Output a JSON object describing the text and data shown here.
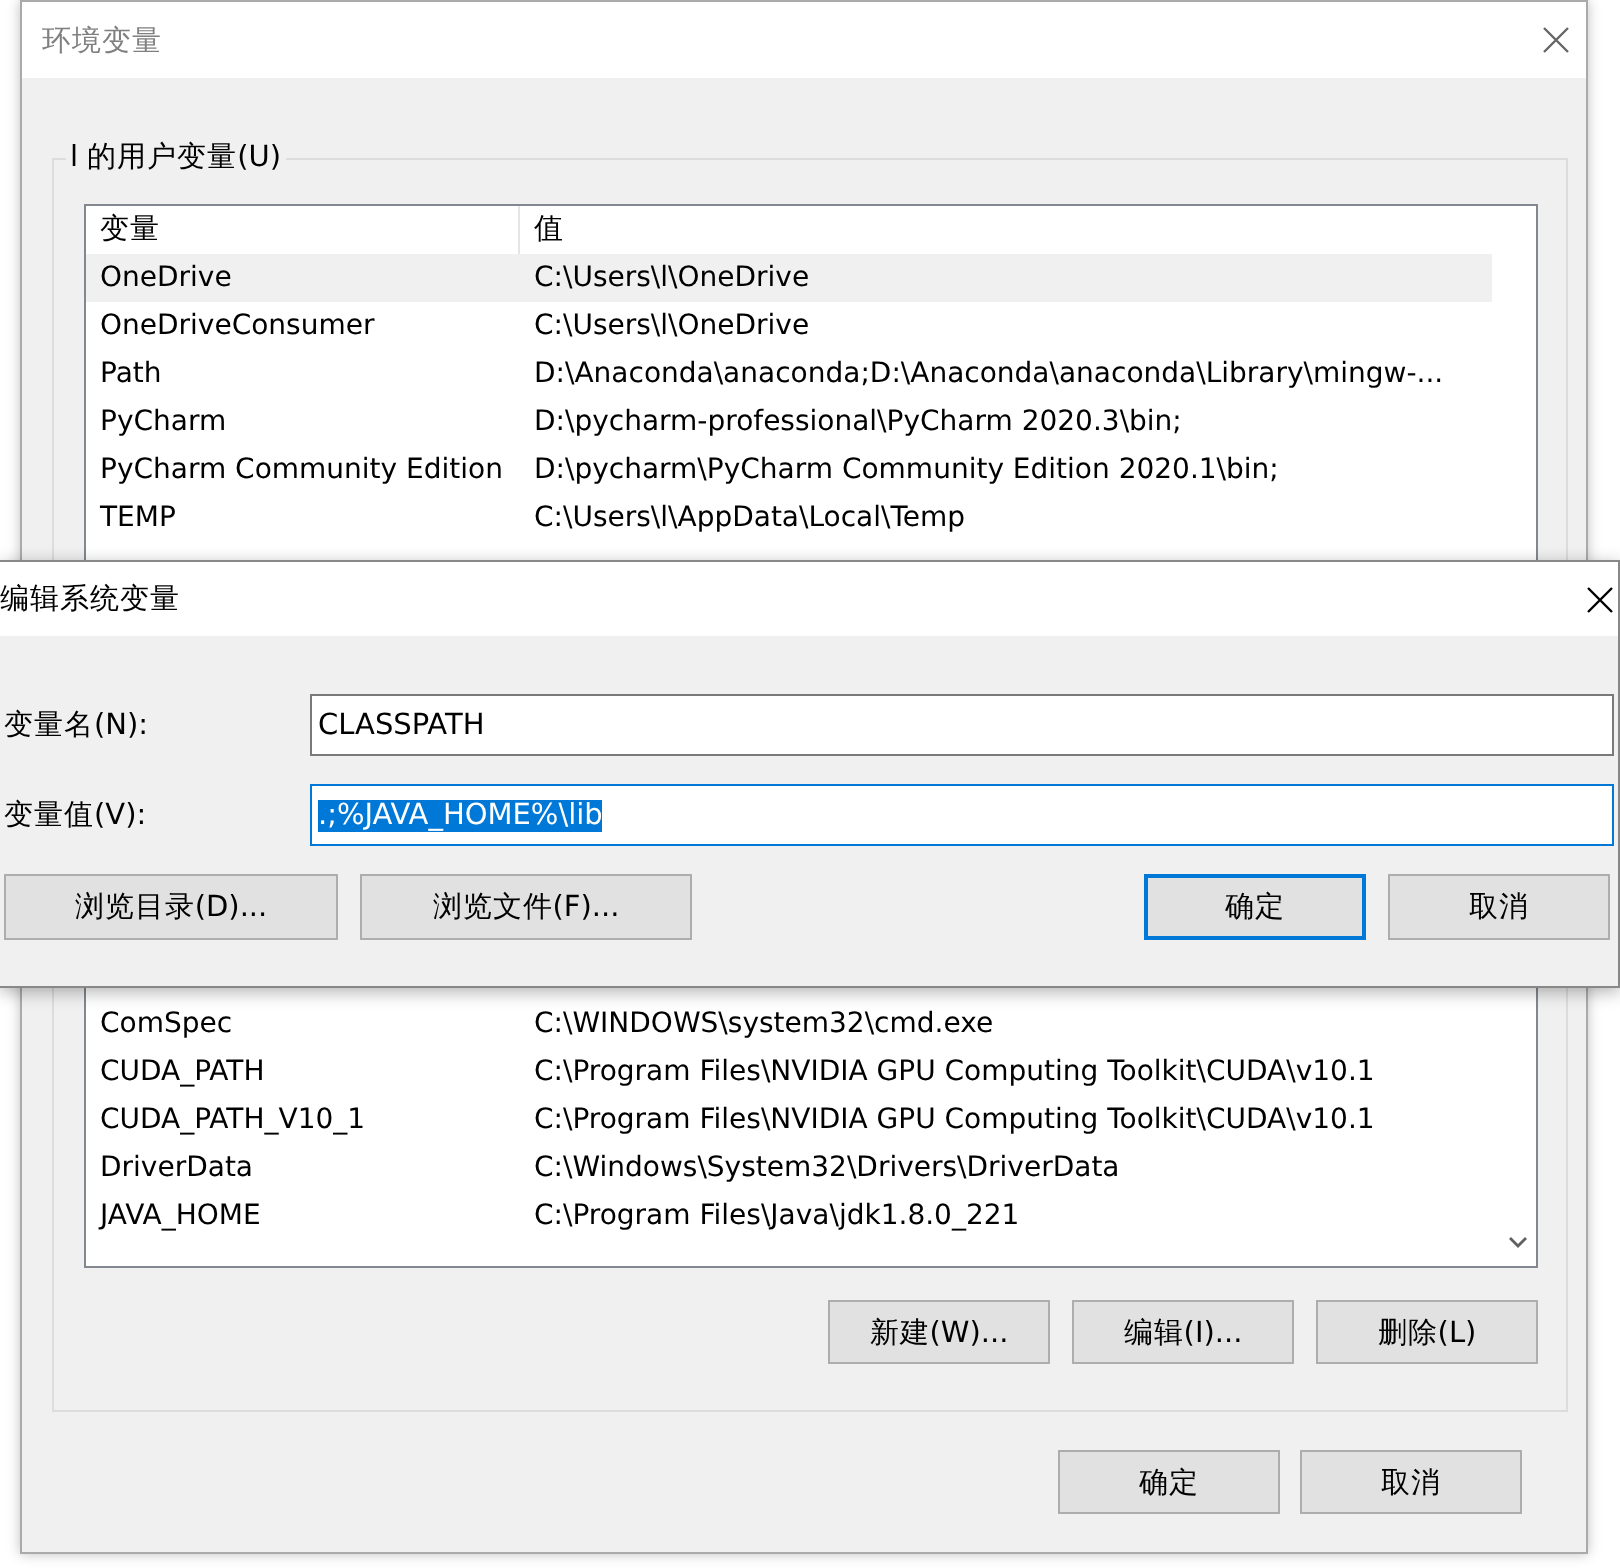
{
  "window": {
    "title": "环境变量"
  },
  "user_variables": {
    "legend": "l 的用户变量(U)",
    "columns": [
      "变量",
      "值"
    ],
    "rows": [
      {
        "name": "OneDrive",
        "value": "C:\\Users\\l\\OneDrive",
        "selected": true
      },
      {
        "name": "OneDriveConsumer",
        "value": "C:\\Users\\l\\OneDrive",
        "selected": false
      },
      {
        "name": "Path",
        "value": "D:\\Anaconda\\anaconda;D:\\Anaconda\\anaconda\\Library\\mingw-...",
        "selected": false
      },
      {
        "name": "PyCharm",
        "value": "D:\\pycharm-professional\\PyCharm 2020.3\\bin;",
        "selected": false
      },
      {
        "name": "PyCharm Community Edition",
        "value": "D:\\pycharm\\PyCharm Community Edition 2020.1\\bin;",
        "selected": false
      },
      {
        "name": "TEMP",
        "value": "C:\\Users\\l\\AppData\\Local\\Temp",
        "selected": false
      }
    ]
  },
  "system_variables": {
    "rows": [
      {
        "name": "ComSpec",
        "value": "C:\\WINDOWS\\system32\\cmd.exe",
        "selected": false
      },
      {
        "name": "CUDA_PATH",
        "value": "C:\\Program Files\\NVIDIA GPU Computing Toolkit\\CUDA\\v10.1",
        "selected": false
      },
      {
        "name": "CUDA_PATH_V10_1",
        "value": "C:\\Program Files\\NVIDIA GPU Computing Toolkit\\CUDA\\v10.1",
        "selected": false
      },
      {
        "name": "DriverData",
        "value": "C:\\Windows\\System32\\Drivers\\DriverData",
        "selected": false
      },
      {
        "name": "JAVA_HOME",
        "value": "C:\\Program Files\\Java\\jdk1.8.0_221",
        "selected": false
      }
    ],
    "buttons": [
      "新建(W)...",
      "编辑(I)...",
      "删除(L)"
    ]
  },
  "buttons": [
    {
      "label": "确定",
      "default": false
    },
    {
      "label": "取消",
      "default": false
    }
  ],
  "edit_dialog": {
    "title": "编辑系统变量",
    "fields": [
      {
        "label": "变量名(N):",
        "value": "CLASSPATH",
        "focused": false,
        "text_selected": false
      },
      {
        "label": "变量值(V):",
        "value": ".;%JAVA_HOME%\\lib",
        "focused": true,
        "text_selected": true
      }
    ],
    "browse_buttons": [
      "浏览目录(D)...",
      "浏览文件(F)..."
    ],
    "buttons": [
      {
        "label": "确定",
        "default": true
      },
      {
        "label": "取消",
        "default": false
      }
    ]
  }
}
